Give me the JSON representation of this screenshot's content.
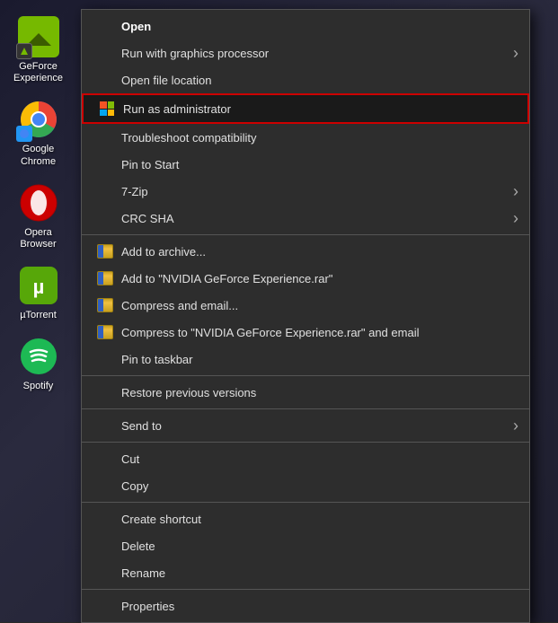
{
  "desktop": {
    "background": "#1a1a2e"
  },
  "taskbar_icons": [
    {
      "id": "nvidia-geforce",
      "label": "GeForce\nExperience",
      "icon_type": "nvidia",
      "color": "#76b900"
    },
    {
      "id": "google-chrome",
      "label": "Google\nChrome",
      "icon_type": "chrome",
      "color": "#4285f4"
    },
    {
      "id": "opera",
      "label": "Opera\nBrowser",
      "icon_type": "opera",
      "color": "#cc0000"
    },
    {
      "id": "utorrent",
      "label": "µTorrent",
      "icon_type": "utorrent",
      "color": "#57a709"
    },
    {
      "id": "spotify",
      "label": "Spotify",
      "icon_type": "spotify",
      "color": "#1db954"
    }
  ],
  "context_menu": {
    "items": [
      {
        "id": "open",
        "label": "Open",
        "bold": true,
        "has_icon": false,
        "has_arrow": false,
        "highlighted": false,
        "divider_after": false
      },
      {
        "id": "run-with-gpu",
        "label": "Run with graphics processor",
        "bold": false,
        "has_icon": false,
        "has_arrow": true,
        "highlighted": false,
        "divider_after": false
      },
      {
        "id": "open-file-location",
        "label": "Open file location",
        "bold": false,
        "has_icon": false,
        "has_arrow": false,
        "highlighted": false,
        "divider_after": false
      },
      {
        "id": "run-as-admin",
        "label": "Run as administrator",
        "bold": false,
        "has_icon": true,
        "icon_type": "win-flag",
        "has_arrow": false,
        "highlighted": true,
        "divider_after": false
      },
      {
        "id": "troubleshoot",
        "label": "Troubleshoot compatibility",
        "bold": false,
        "has_icon": false,
        "has_arrow": false,
        "highlighted": false,
        "divider_after": false
      },
      {
        "id": "pin-to-start",
        "label": "Pin to Start",
        "bold": false,
        "has_icon": false,
        "has_arrow": false,
        "highlighted": false,
        "divider_after": false
      },
      {
        "id": "7zip",
        "label": "7-Zip",
        "bold": false,
        "has_icon": false,
        "has_arrow": true,
        "highlighted": false,
        "divider_after": false
      },
      {
        "id": "crc-sha",
        "label": "CRC SHA",
        "bold": false,
        "has_icon": false,
        "has_arrow": true,
        "highlighted": false,
        "divider_after": true
      },
      {
        "id": "add-to-archive",
        "label": "Add to archive...",
        "bold": false,
        "has_icon": true,
        "icon_type": "winrar",
        "has_arrow": false,
        "highlighted": false,
        "divider_after": false
      },
      {
        "id": "add-to-rar",
        "label": "Add to \"NVIDIA GeForce Experience.rar\"",
        "bold": false,
        "has_icon": true,
        "icon_type": "winrar",
        "has_arrow": false,
        "highlighted": false,
        "divider_after": false
      },
      {
        "id": "compress-email",
        "label": "Compress and email...",
        "bold": false,
        "has_icon": true,
        "icon_type": "winrar",
        "has_arrow": false,
        "highlighted": false,
        "divider_after": false
      },
      {
        "id": "compress-to-rar-email",
        "label": "Compress to \"NVIDIA GeForce Experience.rar\" and email",
        "bold": false,
        "has_icon": true,
        "icon_type": "winrar",
        "has_arrow": false,
        "highlighted": false,
        "divider_after": false
      },
      {
        "id": "pin-taskbar",
        "label": "Pin to taskbar",
        "bold": false,
        "has_icon": false,
        "has_arrow": false,
        "highlighted": false,
        "divider_after": true
      },
      {
        "id": "restore-versions",
        "label": "Restore previous versions",
        "bold": false,
        "has_icon": false,
        "has_arrow": false,
        "highlighted": false,
        "divider_after": true
      },
      {
        "id": "send-to",
        "label": "Send to",
        "bold": false,
        "has_icon": false,
        "has_arrow": true,
        "highlighted": false,
        "divider_after": true
      },
      {
        "id": "cut",
        "label": "Cut",
        "bold": false,
        "has_icon": false,
        "has_arrow": false,
        "highlighted": false,
        "divider_after": false
      },
      {
        "id": "copy",
        "label": "Copy",
        "bold": false,
        "has_icon": false,
        "has_arrow": false,
        "highlighted": false,
        "divider_after": true
      },
      {
        "id": "create-shortcut",
        "label": "Create shortcut",
        "bold": false,
        "has_icon": false,
        "has_arrow": false,
        "highlighted": false,
        "divider_after": false
      },
      {
        "id": "delete",
        "label": "Delete",
        "bold": false,
        "has_icon": false,
        "has_arrow": false,
        "highlighted": false,
        "divider_after": false
      },
      {
        "id": "rename",
        "label": "Rename",
        "bold": false,
        "has_icon": false,
        "has_arrow": false,
        "highlighted": false,
        "divider_after": true
      },
      {
        "id": "properties",
        "label": "Properties",
        "bold": false,
        "has_icon": false,
        "has_arrow": false,
        "highlighted": false,
        "divider_after": false
      }
    ]
  }
}
